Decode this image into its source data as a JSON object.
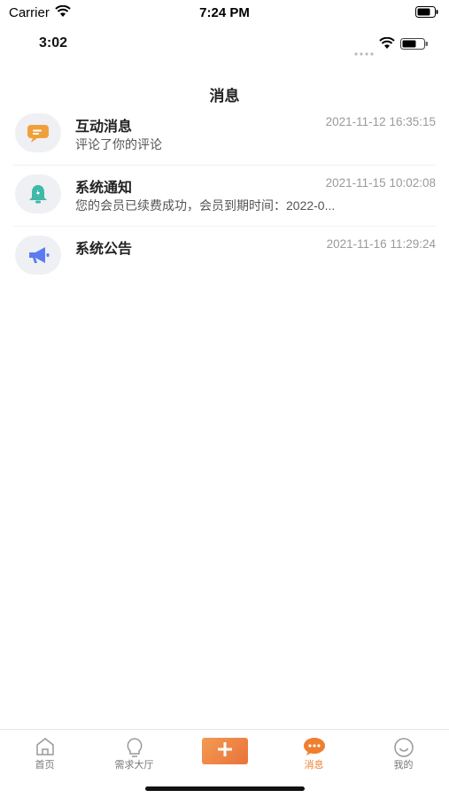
{
  "outer_status": {
    "carrier": "Carrier",
    "time": "7:24 PM"
  },
  "inner_status": {
    "time": "3:02"
  },
  "nav": {
    "title": "消息"
  },
  "messages": [
    {
      "title": "互动消息",
      "time": "2021-11-12 16:35:15",
      "subtitle": "评论了你的评论",
      "icon": "chat-bubble-icon",
      "icon_color": "#f0a03a"
    },
    {
      "title": "系统通知",
      "time": "2021-11-15 10:02:08",
      "subtitle": "您的会员已续费成功，会员到期时间：2022-0...",
      "icon": "bell-icon",
      "icon_color": "#3fb9a8"
    },
    {
      "title": "系统公告",
      "time": "2021-11-16 11:29:24",
      "subtitle": "",
      "icon": "megaphone-icon",
      "icon_color": "#5b7cf0"
    }
  ],
  "tabbar": {
    "items": [
      {
        "label": "首页",
        "icon": "home-icon"
      },
      {
        "label": "需求大厅",
        "icon": "lightbulb-icon"
      },
      {
        "label": "",
        "icon": "plus-icon"
      },
      {
        "label": "消息",
        "icon": "message-icon",
        "active": true
      },
      {
        "label": "我的",
        "icon": "smile-icon"
      }
    ]
  },
  "colors": {
    "accent": "#ef7e2f",
    "text": "#222222",
    "muted": "#9a9a9a"
  }
}
